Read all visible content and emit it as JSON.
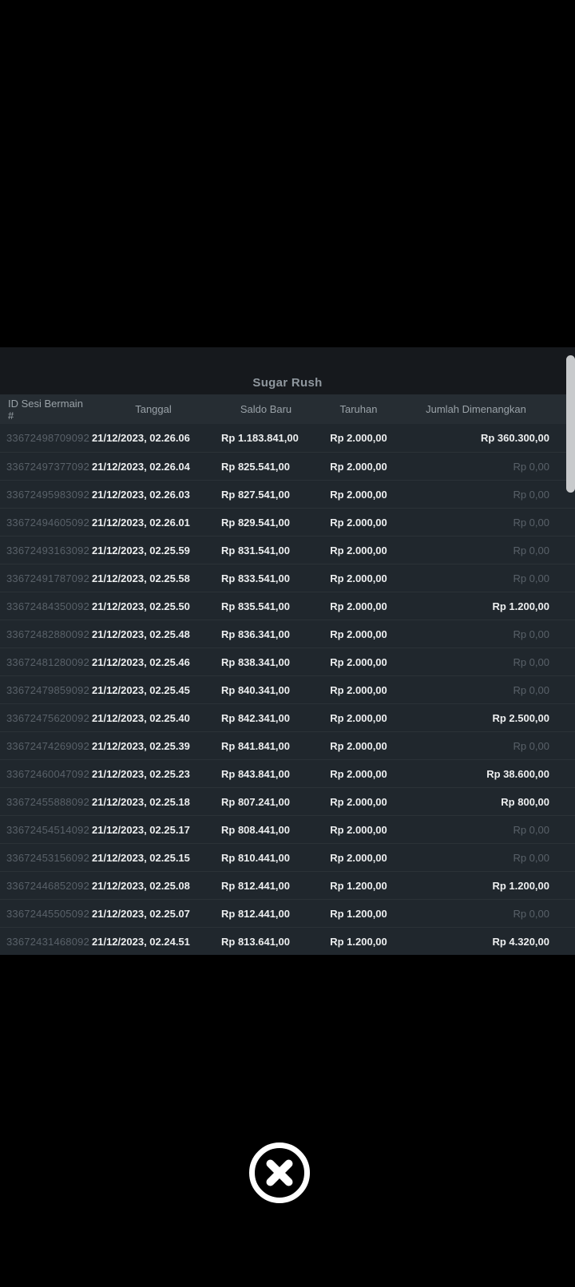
{
  "modal": {
    "title": "Sugar Rush",
    "table": {
      "headers": [
        "ID Sesi Bermain #",
        "Tanggal",
        "Saldo Baru",
        "Taruhan",
        "Jumlah Dimenangkan"
      ],
      "rows": [
        {
          "id": "33672498709092",
          "tanggal": "21/12/2023, 02.26.06",
          "saldo_baru": "Rp 1.183.841,00",
          "taruhan": "Rp 2.000,00",
          "jumlah_dimenangkan": "Rp 360.300,00"
        },
        {
          "id": "33672497377092",
          "tanggal": "21/12/2023, 02.26.04",
          "saldo_baru": "Rp 825.541,00",
          "taruhan": "Rp 2.000,00",
          "jumlah_dimenangkan": "Rp 0,00"
        },
        {
          "id": "33672495983092",
          "tanggal": "21/12/2023, 02.26.03",
          "saldo_baru": "Rp 827.541,00",
          "taruhan": "Rp 2.000,00",
          "jumlah_dimenangkan": "Rp 0,00"
        },
        {
          "id": "33672494605092",
          "tanggal": "21/12/2023, 02.26.01",
          "saldo_baru": "Rp 829.541,00",
          "taruhan": "Rp 2.000,00",
          "jumlah_dimenangkan": "Rp 0,00"
        },
        {
          "id": "33672493163092",
          "tanggal": "21/12/2023, 02.25.59",
          "saldo_baru": "Rp 831.541,00",
          "taruhan": "Rp 2.000,00",
          "jumlah_dimenangkan": "Rp 0,00"
        },
        {
          "id": "33672491787092",
          "tanggal": "21/12/2023, 02.25.58",
          "saldo_baru": "Rp 833.541,00",
          "taruhan": "Rp 2.000,00",
          "jumlah_dimenangkan": "Rp 0,00"
        },
        {
          "id": "33672484350092",
          "tanggal": "21/12/2023, 02.25.50",
          "saldo_baru": "Rp 835.541,00",
          "taruhan": "Rp 2.000,00",
          "jumlah_dimenangkan": "Rp 1.200,00"
        },
        {
          "id": "33672482880092",
          "tanggal": "21/12/2023, 02.25.48",
          "saldo_baru": "Rp 836.341,00",
          "taruhan": "Rp 2.000,00",
          "jumlah_dimenangkan": "Rp 0,00"
        },
        {
          "id": "33672481280092",
          "tanggal": "21/12/2023, 02.25.46",
          "saldo_baru": "Rp 838.341,00",
          "taruhan": "Rp 2.000,00",
          "jumlah_dimenangkan": "Rp 0,00"
        },
        {
          "id": "33672479859092",
          "tanggal": "21/12/2023, 02.25.45",
          "saldo_baru": "Rp 840.341,00",
          "taruhan": "Rp 2.000,00",
          "jumlah_dimenangkan": "Rp 0,00"
        },
        {
          "id": "33672475620092",
          "tanggal": "21/12/2023, 02.25.40",
          "saldo_baru": "Rp 842.341,00",
          "taruhan": "Rp 2.000,00",
          "jumlah_dimenangkan": "Rp 2.500,00"
        },
        {
          "id": "33672474269092",
          "tanggal": "21/12/2023, 02.25.39",
          "saldo_baru": "Rp 841.841,00",
          "taruhan": "Rp 2.000,00",
          "jumlah_dimenangkan": "Rp 0,00"
        },
        {
          "id": "33672460047092",
          "tanggal": "21/12/2023, 02.25.23",
          "saldo_baru": "Rp 843.841,00",
          "taruhan": "Rp 2.000,00",
          "jumlah_dimenangkan": "Rp 38.600,00"
        },
        {
          "id": "33672455888092",
          "tanggal": "21/12/2023, 02.25.18",
          "saldo_baru": "Rp 807.241,00",
          "taruhan": "Rp 2.000,00",
          "jumlah_dimenangkan": "Rp 800,00"
        },
        {
          "id": "33672454514092",
          "tanggal": "21/12/2023, 02.25.17",
          "saldo_baru": "Rp 808.441,00",
          "taruhan": "Rp 2.000,00",
          "jumlah_dimenangkan": "Rp 0,00"
        },
        {
          "id": "33672453156092",
          "tanggal": "21/12/2023, 02.25.15",
          "saldo_baru": "Rp 810.441,00",
          "taruhan": "Rp 2.000,00",
          "jumlah_dimenangkan": "Rp 0,00"
        },
        {
          "id": "33672446852092",
          "tanggal": "21/12/2023, 02.25.08",
          "saldo_baru": "Rp 812.441,00",
          "taruhan": "Rp 1.200,00",
          "jumlah_dimenangkan": "Rp 1.200,00"
        },
        {
          "id": "33672445505092",
          "tanggal": "21/12/2023, 02.25.07",
          "saldo_baru": "Rp 812.441,00",
          "taruhan": "Rp 1.200,00",
          "jumlah_dimenangkan": "Rp 0,00"
        },
        {
          "id": "33672431468092",
          "tanggal": "21/12/2023, 02.24.51",
          "saldo_baru": "Rp 813.641,00",
          "taruhan": "Rp 1.200,00",
          "jumlah_dimenangkan": "Rp 4.320,00"
        }
      ],
      "zero_amount_text": "Rp 0,00"
    }
  },
  "close_button": {
    "icon": "x-circle-icon"
  },
  "colors": {
    "page_bg": "#000000",
    "modal_bg": "#20272d",
    "titlebar_bg": "#16191d",
    "header_bg": "#262d33",
    "text_primary": "#edeff0",
    "text_muted": "#596169",
    "scrollbar": "#c8cacc",
    "close_icon": "#ffffff"
  }
}
